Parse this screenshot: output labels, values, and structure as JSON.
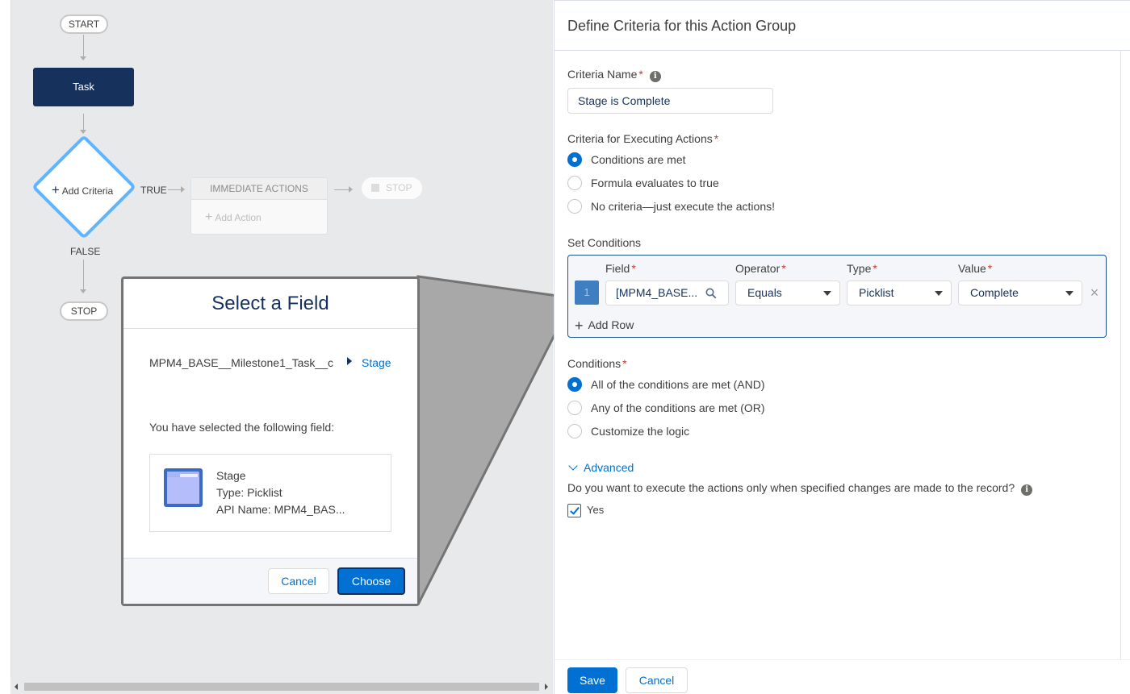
{
  "canvas": {
    "start_label": "START",
    "task_label": "Task",
    "add_criteria_label": "Add Criteria",
    "true_label": "TRUE",
    "false_label": "FALSE",
    "immediate_actions_label": "IMMEDIATE ACTIONS",
    "add_action_label": "Add Action",
    "stop_right_label": "STOP",
    "stop_bottom_label": "STOP"
  },
  "modal": {
    "title": "Select a Field",
    "path_object": "MPM4_BASE__Milestone1_Task__c",
    "path_field": "Stage",
    "selected_intro": "You have selected the following field:",
    "field_name": "Stage",
    "field_type": "Type: Picklist",
    "field_api": "API Name: MPM4_BAS...",
    "cancel_label": "Cancel",
    "choose_label": "Choose"
  },
  "panel": {
    "title": "Define Criteria for this Action Group",
    "criteria_name_label": "Criteria Name",
    "criteria_name_value": "Stage is Complete",
    "executing_label": "Criteria for Executing Actions",
    "executing_options": [
      {
        "label": "Conditions are met",
        "selected": true
      },
      {
        "label": "Formula evaluates to true",
        "selected": false
      },
      {
        "label": "No criteria—just execute the actions!",
        "selected": false
      }
    ],
    "set_conditions_label": "Set Conditions",
    "columns": {
      "field": "Field",
      "operator": "Operator",
      "type": "Type",
      "value": "Value"
    },
    "row": {
      "number": "1",
      "field": "[MPM4_BASE...",
      "operator": "Equals",
      "type": "Picklist",
      "value": "Complete"
    },
    "add_row_label": "Add Row",
    "conditions_label": "Conditions",
    "conditions_options": [
      {
        "label": "All of the conditions are met (AND)",
        "selected": true
      },
      {
        "label": "Any of the conditions are met (OR)",
        "selected": false
      },
      {
        "label": "Customize the logic",
        "selected": false
      }
    ],
    "advanced_label": "Advanced",
    "advanced_question": "Do you want to execute the actions only when specified changes are made to the record?",
    "yes_label": "Yes",
    "yes_checked": true,
    "save_label": "Save",
    "cancel_label": "Cancel"
  },
  "colors": {
    "brand": "#0070d2",
    "task_node": "#16325c",
    "diamond_border": "#5eb4ff",
    "condition_border": "#1b5297",
    "required": "#c23934"
  }
}
